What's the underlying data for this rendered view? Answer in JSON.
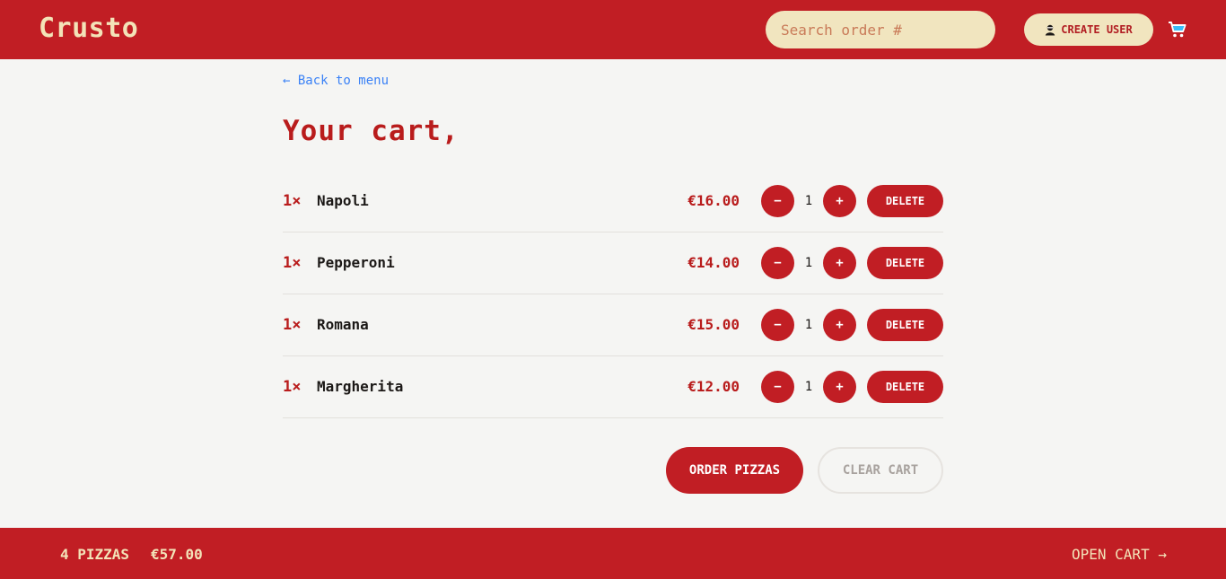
{
  "header": {
    "logo": "Crusto",
    "search_placeholder": "Search order #",
    "create_user_label": "CREATE USER",
    "user_icon": "user-icon",
    "cart_icon": "shopping-cart-icon"
  },
  "main": {
    "back_link": "← Back to menu",
    "title": "Your cart,",
    "items": [
      {
        "qty_prefix": "1×",
        "name": "Napoli",
        "price": "€16.00",
        "quantity": "1",
        "minus": "−",
        "plus": "+",
        "delete": "DELETE"
      },
      {
        "qty_prefix": "1×",
        "name": "Pepperoni",
        "price": "€14.00",
        "quantity": "1",
        "minus": "−",
        "plus": "+",
        "delete": "DELETE"
      },
      {
        "qty_prefix": "1×",
        "name": "Romana",
        "price": "€15.00",
        "quantity": "1",
        "minus": "−",
        "plus": "+",
        "delete": "DELETE"
      },
      {
        "qty_prefix": "1×",
        "name": "Margherita",
        "price": "€12.00",
        "quantity": "1",
        "minus": "−",
        "plus": "+",
        "delete": "DELETE"
      }
    ],
    "order_label": "ORDER PIZZAS",
    "clear_label": "CLEAR CART"
  },
  "footer": {
    "count": "4 PIZZAS",
    "total": "€57.00",
    "open_cart": "OPEN CART →"
  },
  "colors": {
    "brand_red": "#c11e24",
    "cream": "#f3e3b8",
    "background": "#f5f5f3",
    "link_blue": "#3b82f6"
  }
}
